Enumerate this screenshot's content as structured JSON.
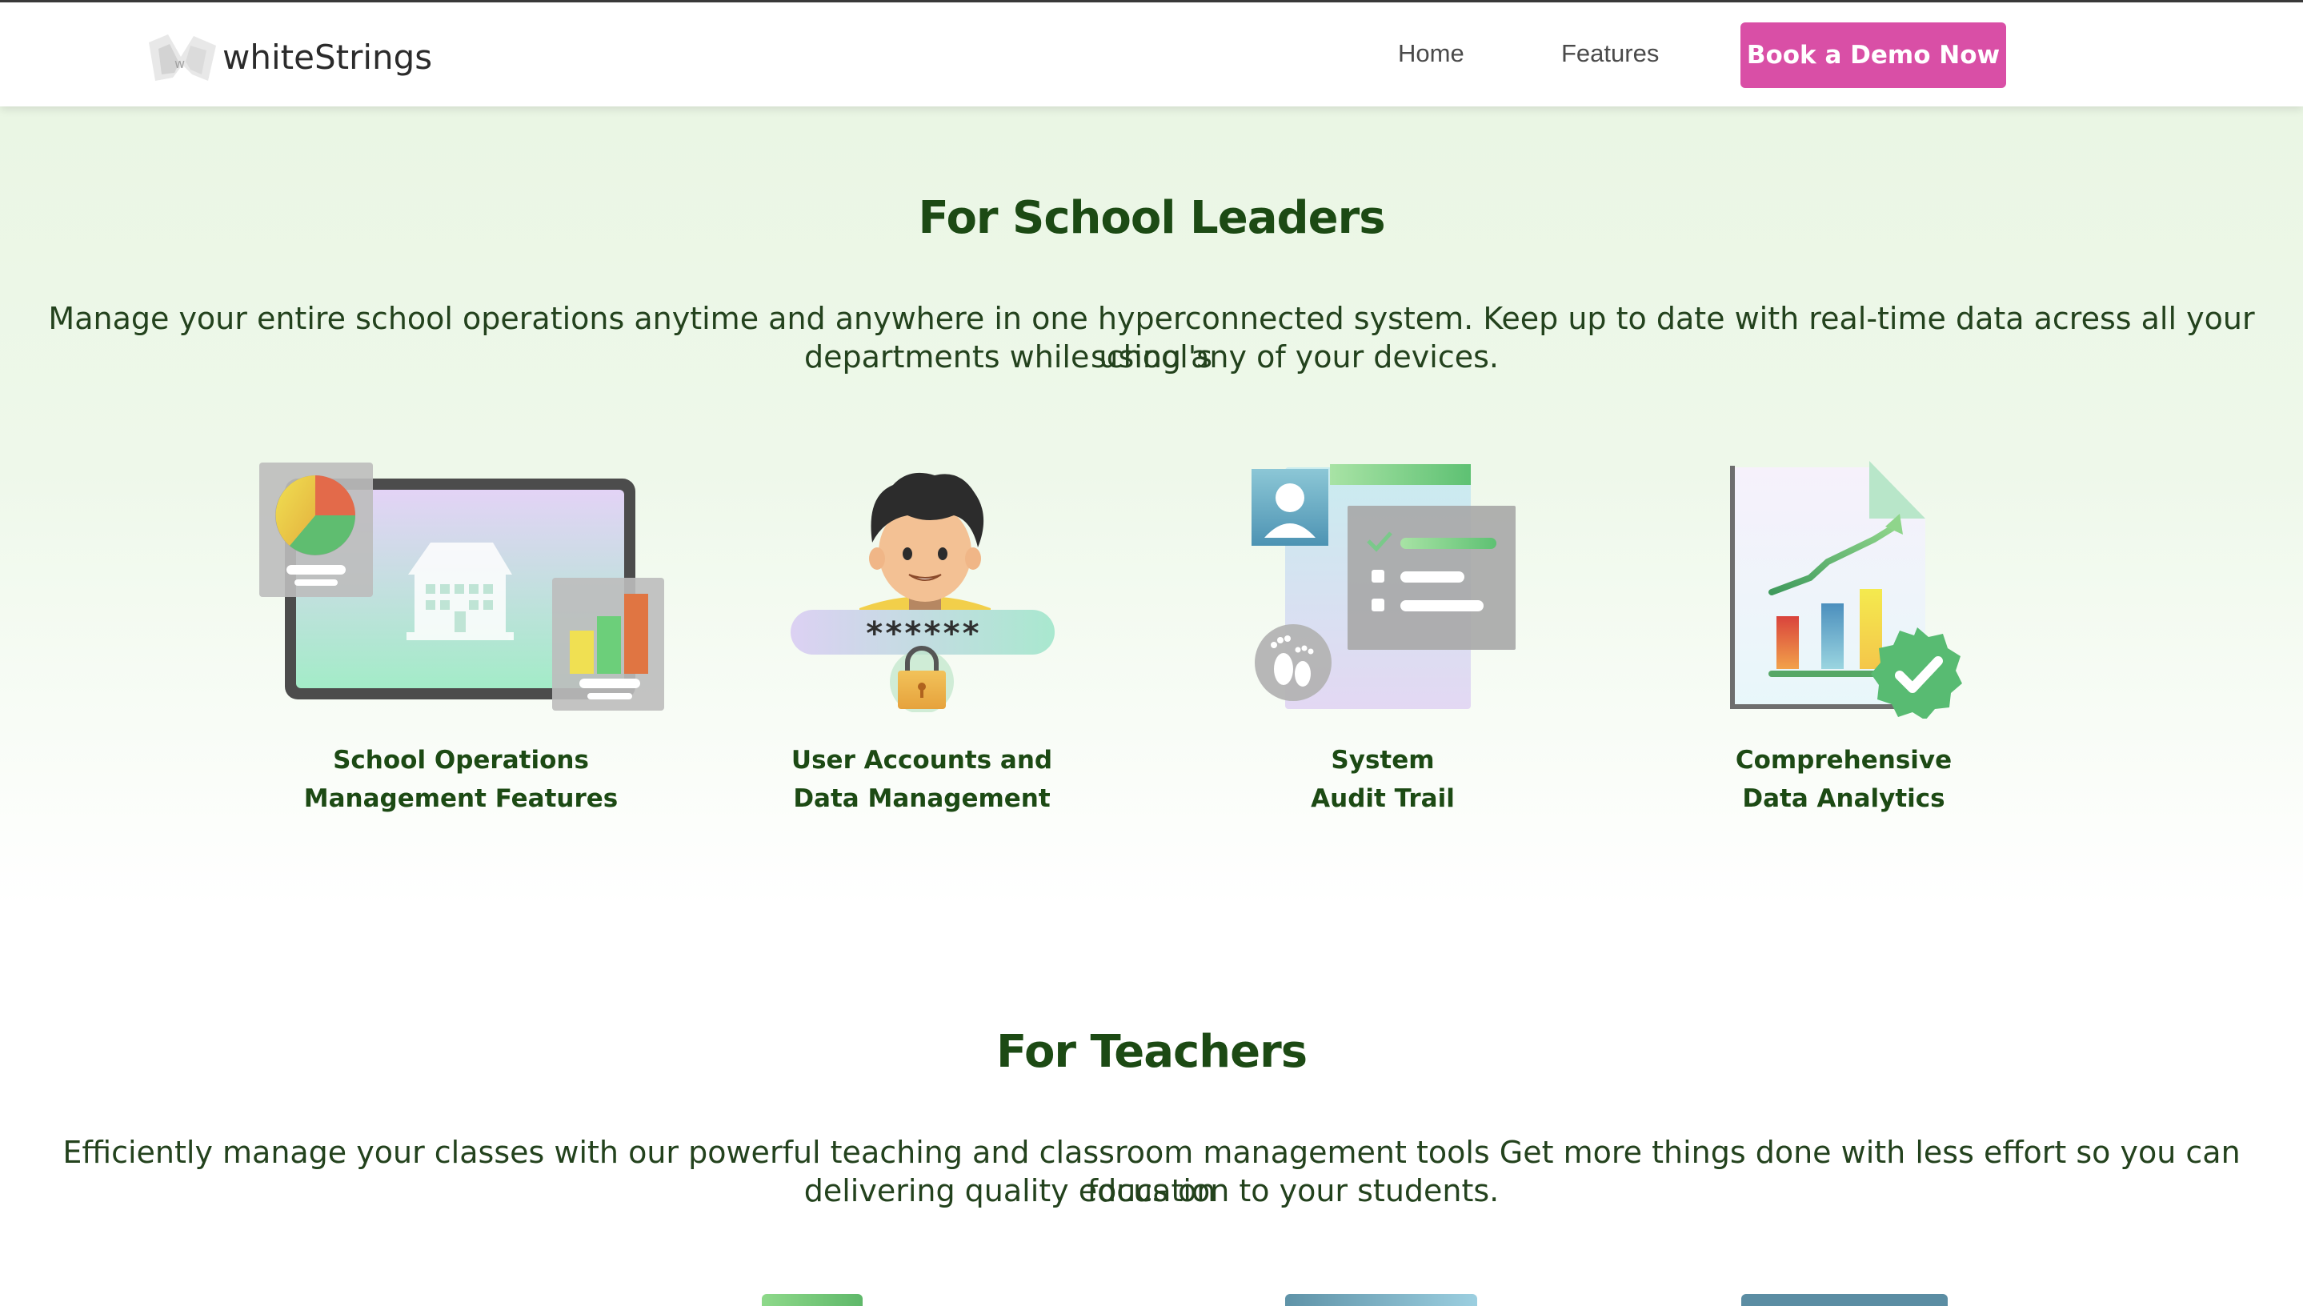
{
  "header": {
    "brand": "whiteStrings",
    "nav": {
      "home": "Home",
      "features": "Features"
    },
    "cta": "Book a Demo Now"
  },
  "leaders": {
    "title": "For School Leaders",
    "description_line1": "Manage your entire school operations anytime and anywhere in one hyperconnected system. Keep up to date with real-time data acress all your school's",
    "description_line2": "departments while using any of your devices.",
    "features": [
      {
        "line1": "School Operations",
        "line2": "Management Features",
        "icon": "school-building-icon"
      },
      {
        "line1": "User Accounts and",
        "line2": "Data Management",
        "icon": "user-password-lock-icon",
        "password_mask": "******"
      },
      {
        "line1": "System",
        "line2": "Audit Trail",
        "icon": "audit-checklist-icon"
      },
      {
        "line1": "Comprehensive",
        "line2": "Data Analytics",
        "icon": "analytics-chart-icon"
      }
    ]
  },
  "teachers": {
    "title": "For Teachers",
    "description_line1": "Efficiently manage your classes with our powerful teaching and classroom management tools Get more things done with less effort so you can focus on",
    "description_line2": "delivering quality education to your students."
  },
  "colors": {
    "accent": "#d94fa6",
    "heading": "#1c4a14",
    "section_bg": "#eaf6e4"
  }
}
